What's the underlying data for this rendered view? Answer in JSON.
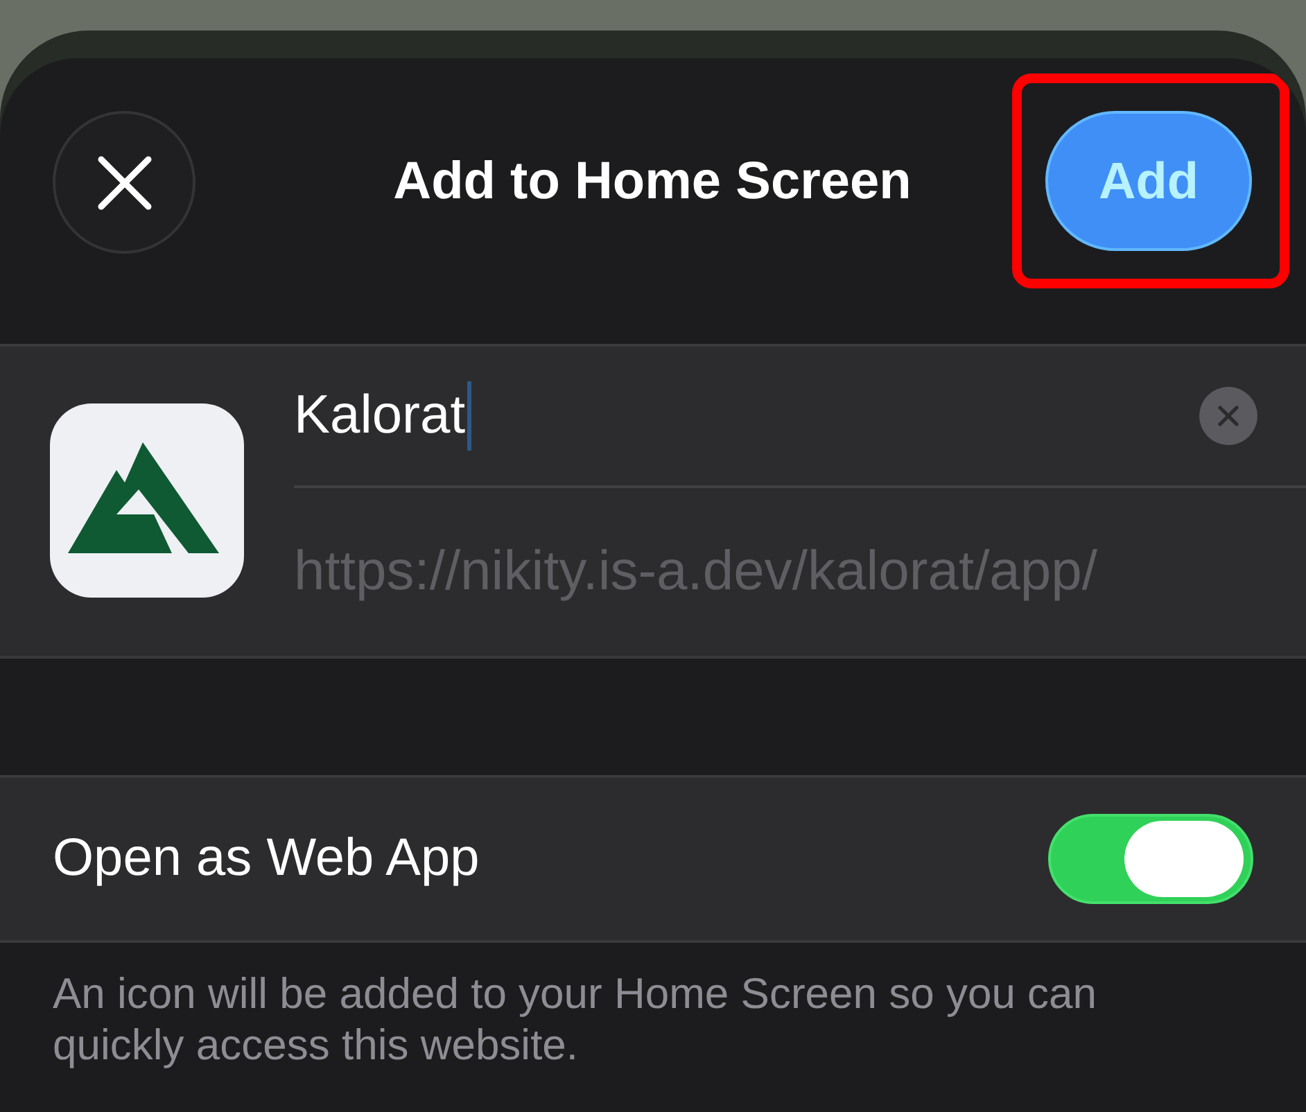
{
  "header": {
    "title": "Add to Home Screen",
    "add_button": {
      "label": "Add",
      "highlighted": true
    }
  },
  "app": {
    "name_field": {
      "value": "Kalorat",
      "focused": true
    },
    "url": "https://nikity.is-a.dev/kalorat/app/"
  },
  "settings": [
    {
      "kind": "toggle",
      "label": "Open as Web App",
      "on": true
    }
  ],
  "footer": "An icon will be added to your Home Screen so you can quickly access this website."
}
